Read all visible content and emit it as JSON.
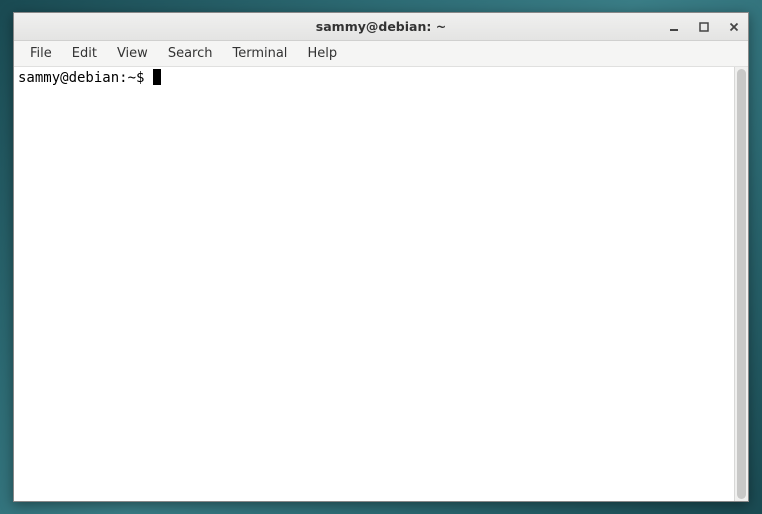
{
  "window": {
    "title": "sammy@debian: ~"
  },
  "menubar": {
    "items": [
      {
        "label": "File"
      },
      {
        "label": "Edit"
      },
      {
        "label": "View"
      },
      {
        "label": "Search"
      },
      {
        "label": "Terminal"
      },
      {
        "label": "Help"
      }
    ]
  },
  "terminal": {
    "prompt": "sammy@debian:~$ "
  }
}
